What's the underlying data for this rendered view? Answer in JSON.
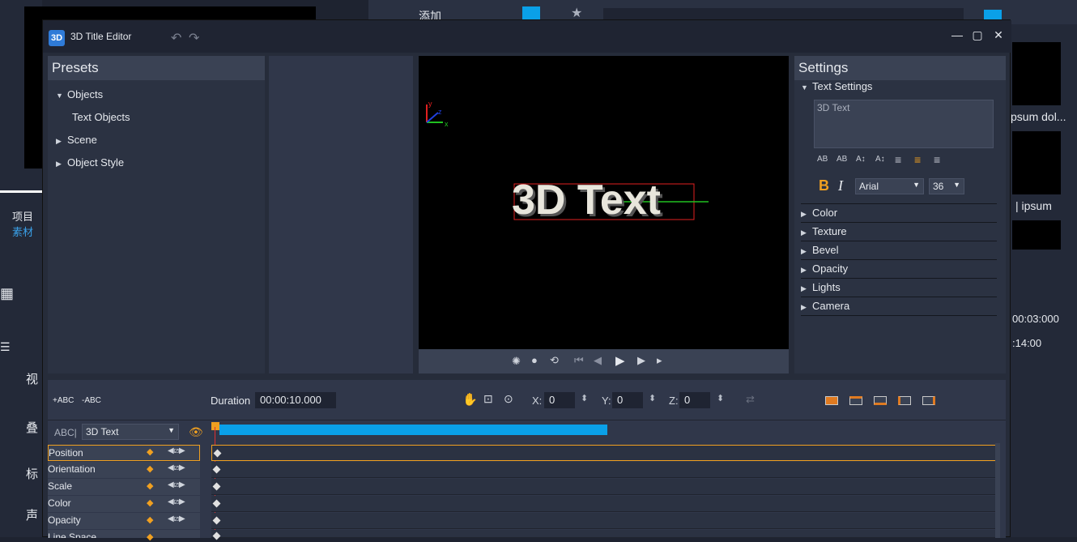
{
  "window": {
    "title": "3D Title Editor",
    "icon_label": "3D"
  },
  "presets": {
    "header": "Presets",
    "items": [
      {
        "label": "Objects",
        "expanded": true
      },
      {
        "label": "Text Objects"
      },
      {
        "label": "Scene",
        "expanded": false
      },
      {
        "label": "Object Style",
        "expanded": false
      }
    ]
  },
  "preview": {
    "text": "3D Text",
    "axes": {
      "x": "x",
      "y": "y",
      "z": "z"
    }
  },
  "settings": {
    "header": "Settings",
    "text_settings_label": "Text Settings",
    "text_value": "3D Text",
    "font": "Arial",
    "size": "36",
    "bold": "B",
    "italic": "I",
    "sections": [
      "Color",
      "Texture",
      "Bevel",
      "Opacity",
      "Lights",
      "Camera"
    ]
  },
  "timeline": {
    "add_abc": "+ABC",
    "remove_abc": "-ABC",
    "duration_label": "Duration",
    "duration_value": "00:00:10.000",
    "x_label": "X:",
    "x_value": "0",
    "y_label": "Y:",
    "y_value": "0",
    "z_label": "Z:",
    "z_value": "0",
    "object_type": "ABC|",
    "object_name": "3D Text",
    "tracks": [
      "Position",
      "Orientation",
      "Scale",
      "Color",
      "Opacity",
      "Line Space"
    ]
  },
  "background_app": {
    "add_label": "添加",
    "project_label": "项目",
    "material_label": "素材",
    "video_label": "视",
    "overlay_label": "叠",
    "title_label": "标",
    "audio_label": "声",
    "time1": "00:03:000",
    "time2": ":14:00",
    "thumb1_text": "psum dol...",
    "thumb2_text": "| ipsum"
  },
  "colors": {
    "accent_blue": "#0aa0e8",
    "accent_orange": "#f0a020",
    "panel_bg": "#2b3242",
    "header_bg": "#3a4254"
  }
}
